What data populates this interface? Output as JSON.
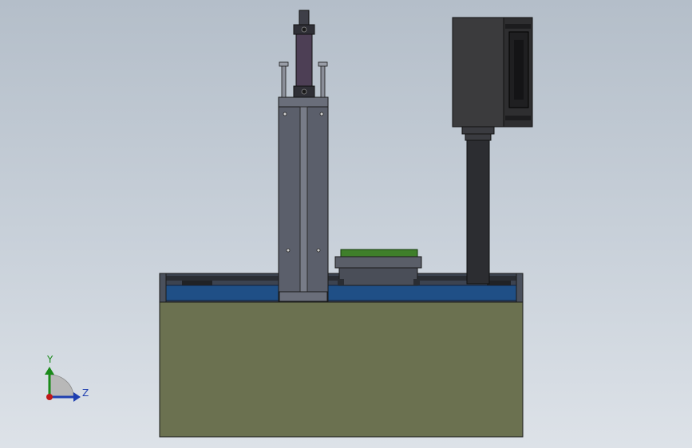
{
  "scene": {
    "colors": {
      "background_top": "#b4bec9",
      "background_bottom": "#dde2e8",
      "base_block": "#6b7150",
      "rail_blue": "#1f4f86",
      "column_gray": "#5b5f6b",
      "cylinder_purple": "#4d3f55",
      "camera_body": "#3b3b3d",
      "pcb_green": "#3f7f2a",
      "outline": "#1a1a1a"
    }
  },
  "triad": {
    "y_label": "Y",
    "z_label": "Z",
    "y_color": "#1a8a1a",
    "z_color": "#1f3fb0",
    "x_color": "#c01818"
  }
}
